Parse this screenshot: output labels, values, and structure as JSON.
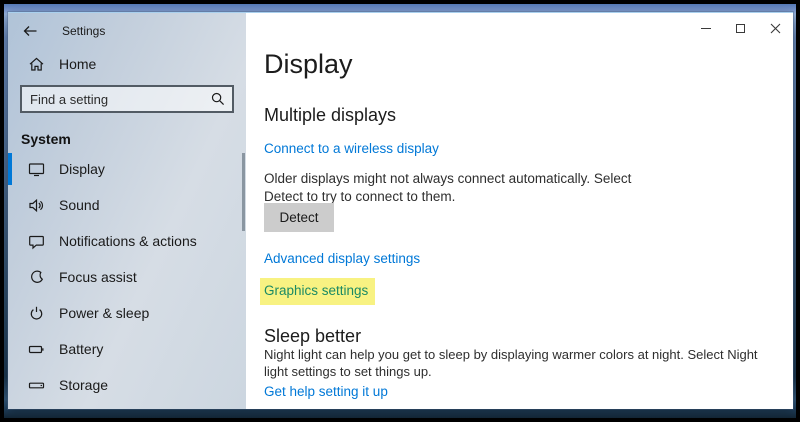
{
  "colors": {
    "accent_blue": "#0078d7",
    "link_blue": "#0078d7",
    "highlight_yellow": "#f8f282",
    "highlight_text_green": "#1a8a64",
    "button_gray": "#cccccc"
  },
  "window": {
    "title": "Settings"
  },
  "sidebar": {
    "home_label": "Home",
    "search_placeholder": "Find a setting",
    "section_header": "System",
    "items": [
      {
        "label": "Display",
        "icon": "display-icon",
        "selected": true
      },
      {
        "label": "Sound",
        "icon": "sound-icon",
        "selected": false
      },
      {
        "label": "Notifications & actions",
        "icon": "notifications-icon",
        "selected": false
      },
      {
        "label": "Focus assist",
        "icon": "focus-assist-icon",
        "selected": false
      },
      {
        "label": "Power & sleep",
        "icon": "power-icon",
        "selected": false
      },
      {
        "label": "Battery",
        "icon": "battery-icon",
        "selected": false
      },
      {
        "label": "Storage",
        "icon": "storage-icon",
        "selected": false
      }
    ]
  },
  "main": {
    "page_title": "Display",
    "multiple_displays": {
      "heading": "Multiple displays",
      "wireless_link": "Connect to a wireless display",
      "description": "Older displays might not always connect automatically. Select Detect to try to connect to them.",
      "detect_button": "Detect",
      "advanced_link": "Advanced display settings",
      "graphics_link": "Graphics settings"
    },
    "sleep_better": {
      "heading": "Sleep better",
      "description": "Night light can help you get to sleep by displaying warmer colors at night. Select Night light settings to set things up.",
      "help_link": "Get help setting it up"
    }
  }
}
